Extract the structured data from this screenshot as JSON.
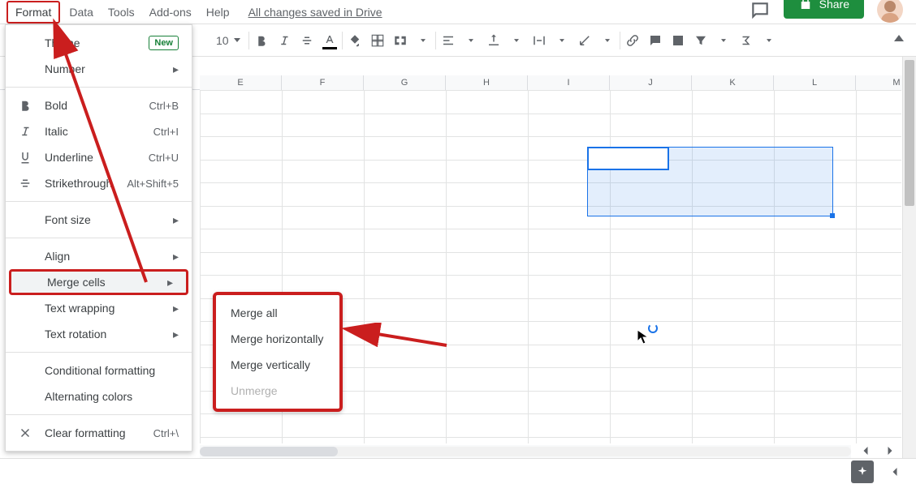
{
  "menubar": {
    "format": "Format",
    "data": "Data",
    "tools": "Tools",
    "addons": "Add-ons",
    "help": "Help",
    "saved": "All changes saved in Drive"
  },
  "share_label": "Share",
  "font_size": "10",
  "column_headers": [
    "E",
    "F",
    "G",
    "H",
    "I",
    "J",
    "K",
    "L",
    "M"
  ],
  "dropdown": {
    "theme": "Theme",
    "new_badge": "New",
    "number": "Number",
    "bold": {
      "label": "Bold",
      "shortcut": "Ctrl+B"
    },
    "italic": {
      "label": "Italic",
      "shortcut": "Ctrl+I"
    },
    "underline": {
      "label": "Underline",
      "shortcut": "Ctrl+U"
    },
    "strike": {
      "label": "Strikethrough",
      "shortcut": "Alt+Shift+5"
    },
    "font_size": "Font size",
    "align": "Align",
    "merge": "Merge cells",
    "wrap": "Text wrapping",
    "rotate": "Text rotation",
    "cond": "Conditional formatting",
    "alt": "Alternating colors",
    "clear": {
      "label": "Clear formatting",
      "shortcut": "Ctrl+\\"
    }
  },
  "submenu": {
    "merge_all": "Merge all",
    "merge_h": "Merge horizontally",
    "merge_v": "Merge vertically",
    "unmerge": "Unmerge"
  }
}
